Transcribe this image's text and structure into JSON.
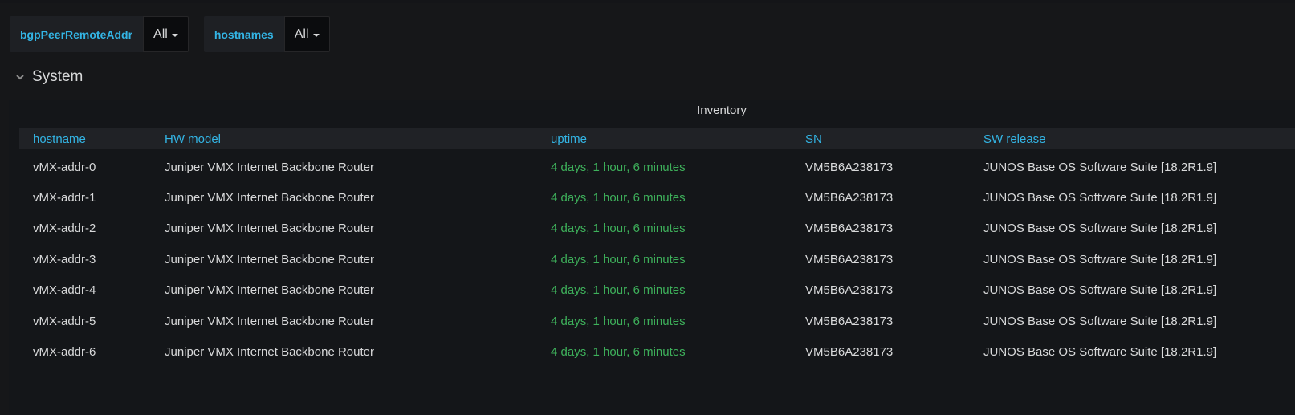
{
  "variables": [
    {
      "label": "bgpPeerRemoteAddr",
      "value": "All"
    },
    {
      "label": "hostnames",
      "value": "All"
    }
  ],
  "row": {
    "title": "System"
  },
  "panel": {
    "title": "Inventory",
    "columns": [
      "hostname",
      "HW model",
      "uptime",
      "SN",
      "SW release"
    ],
    "rows": [
      [
        "vMX-addr-0",
        "Juniper VMX Internet Backbone Router",
        "4 days, 1 hour, 6 minutes",
        "VM5B6A238173",
        "JUNOS Base OS Software Suite [18.2R1.9]"
      ],
      [
        "vMX-addr-1",
        "Juniper VMX Internet Backbone Router",
        "4 days, 1 hour, 6 minutes",
        "VM5B6A238173",
        "JUNOS Base OS Software Suite [18.2R1.9]"
      ],
      [
        "vMX-addr-2",
        "Juniper VMX Internet Backbone Router",
        "4 days, 1 hour, 6 minutes",
        "VM5B6A238173",
        "JUNOS Base OS Software Suite [18.2R1.9]"
      ],
      [
        "vMX-addr-3",
        "Juniper VMX Internet Backbone Router",
        "4 days, 1 hour, 6 minutes",
        "VM5B6A238173",
        "JUNOS Base OS Software Suite [18.2R1.9]"
      ],
      [
        "vMX-addr-4",
        "Juniper VMX Internet Backbone Router",
        "4 days, 1 hour, 6 minutes",
        "VM5B6A238173",
        "JUNOS Base OS Software Suite [18.2R1.9]"
      ],
      [
        "vMX-addr-5",
        "Juniper VMX Internet Backbone Router",
        "4 days, 1 hour, 6 minutes",
        "VM5B6A238173",
        "JUNOS Base OS Software Suite [18.2R1.9]"
      ],
      [
        "vMX-addr-6",
        "Juniper VMX Internet Backbone Router",
        "4 days, 1 hour, 6 minutes",
        "VM5B6A238173",
        "JUNOS Base OS Software Suite [18.2R1.9]"
      ]
    ]
  },
  "colors": {
    "background": "#161719",
    "header_link": "#33b5e5",
    "uptime_text": "#3eb15b"
  }
}
